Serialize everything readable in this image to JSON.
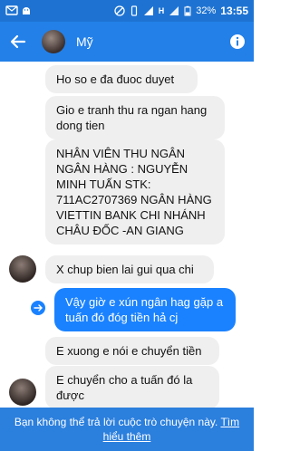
{
  "status_bar": {
    "battery": "32%",
    "time": "13:55",
    "network": "H"
  },
  "header": {
    "title": "Mỹ"
  },
  "messages": [
    {
      "text": "Ho so e đa đuoc duyet",
      "direction": "in"
    },
    {
      "text": "Gio e tranh thu ra ngan hang dong tien",
      "direction": "in"
    },
    {
      "text": "NHÂN VIÊN THU NGÂN NGÂN HÀNG : NGUYỄN MINH TUẤN STK: 711AC2707369 NGÂN HÀNG VIETTIN BANK CHI NHÁNH CHÂU ĐỐC -AN GIANG",
      "direction": "in"
    },
    {
      "text": "X chup bien lai gui qua chi",
      "direction": "in"
    },
    {
      "text": "Vậy giờ e xún ngân hag gặp a tuấn đó đóg tiền hả cj",
      "direction": "out"
    },
    {
      "text": "E xuong e nói e chuyển tiền",
      "direction": "in"
    },
    {
      "text": "E chuyển cho a tuấn đó la được",
      "direction": "in"
    }
  ],
  "footer": {
    "notice": "Bạn không thể trả lời cuộc trò chuyện này.",
    "link": "Tìm hiểu thêm"
  },
  "colors": {
    "status_bar": "#1e73d2",
    "header": "#2380e8",
    "outgoing_bubble": "#1a82ff",
    "incoming_bubble": "#efefef",
    "footer": "#2b7fdd"
  }
}
